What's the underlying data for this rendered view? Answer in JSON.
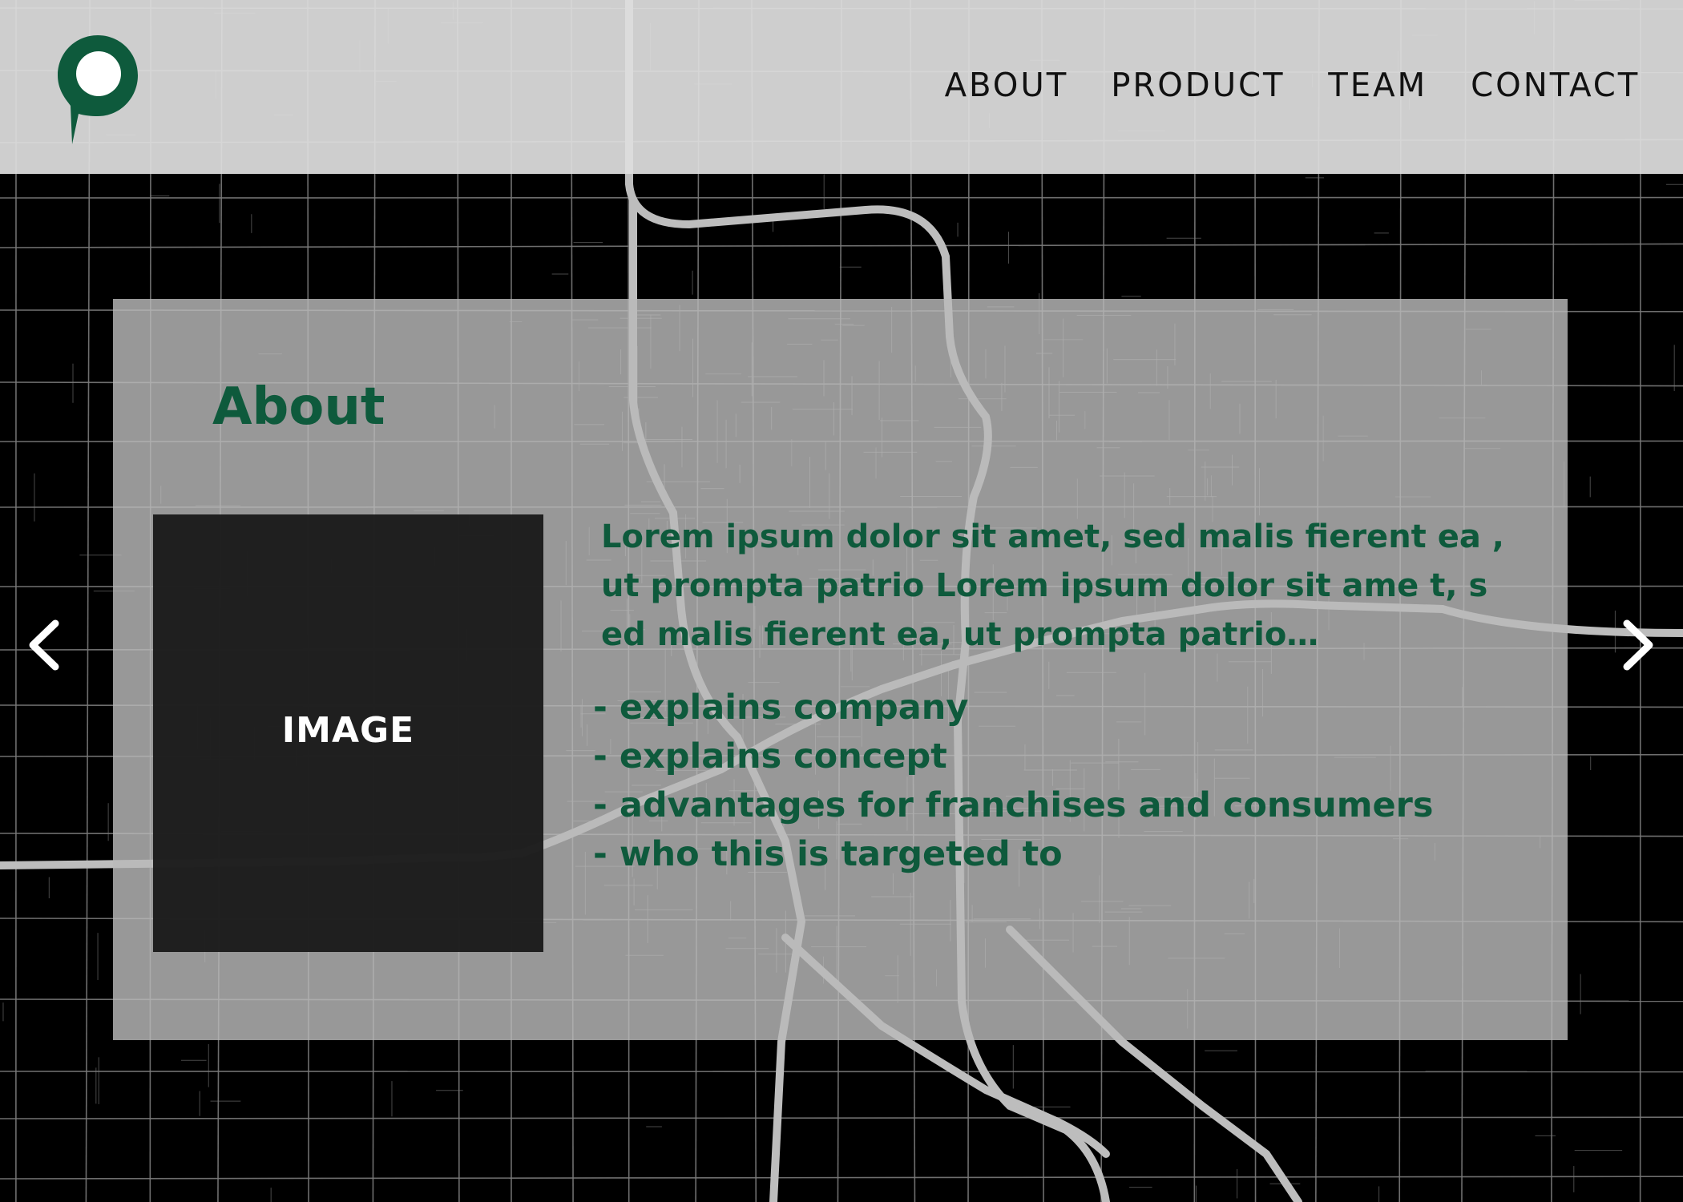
{
  "header": {
    "logo_icon": "map-pin-icon",
    "nav": [
      {
        "label": "ABOUT"
      },
      {
        "label": "PRODUCT"
      },
      {
        "label": "TEAM"
      },
      {
        "label": "CONTACT"
      }
    ]
  },
  "main": {
    "title": "About",
    "image_label": "IMAGE",
    "description": "Lorem ipsum dolor sit amet, sed malis fierent ea , ut prompta patrio Lorem ipsum dolor sit ame t, sed malis fierent ea, ut prompta patrio…",
    "bullets": [
      "- explains company",
      "- explains concept",
      "- advantages for franchises and consumers",
      "- who this is targeted to"
    ]
  },
  "carousel": {
    "prev_icon": "chevron-left-icon",
    "next_icon": "chevron-right-icon"
  },
  "colors": {
    "accent": "#0e5a3c",
    "page_background": "#000000",
    "header_background": "#dedede",
    "panel_background": "#b9b9b9",
    "image_placeholder": "#161616"
  }
}
